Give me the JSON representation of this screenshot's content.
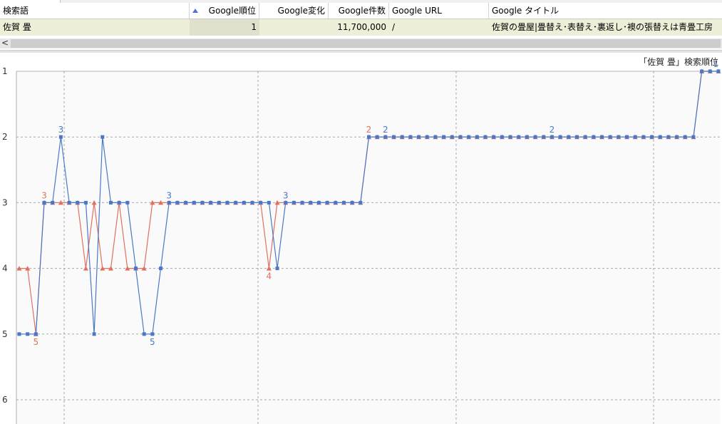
{
  "table": {
    "columns": [
      {
        "key": "keyword",
        "label": "検索語"
      },
      {
        "key": "rank",
        "label": "Google順位"
      },
      {
        "key": "change",
        "label": "Google変化"
      },
      {
        "key": "count",
        "label": "Google件数"
      },
      {
        "key": "url",
        "label": "Google URL"
      },
      {
        "key": "title",
        "label": "Google タイトル"
      }
    ],
    "rows": [
      {
        "keyword": "佐賀 畳",
        "rank": "1",
        "change": "",
        "count": "11,700,000",
        "url": "/",
        "title": "佐賀の畳屋|畳替え･表替え･裏返し･襖の張替えは青畳工房"
      }
    ]
  },
  "scroll": {
    "left_arrow": "<"
  },
  "chart_data": {
    "type": "line",
    "title": "「佐賀 畳」検索順位",
    "xlabel": "",
    "ylabel": "",
    "ylim": [
      1,
      6
    ],
    "y_inverted": true,
    "yticks": [
      "1",
      "2",
      "3",
      "4",
      "5",
      "6"
    ],
    "grid": true,
    "series": [
      {
        "name": "",
        "color": "#e07060",
        "marker": "triangle",
        "values": [
          4,
          4,
          5,
          3,
          3,
          3,
          3,
          3,
          4,
          3,
          4,
          4,
          3,
          4,
          4,
          4,
          3,
          3,
          3,
          3,
          3,
          3,
          3,
          3,
          3,
          3,
          3,
          3,
          3,
          3,
          4,
          3,
          3,
          3,
          3,
          3,
          3,
          3,
          3,
          3,
          3,
          3,
          2,
          2,
          2,
          2,
          2,
          2,
          2,
          2,
          2,
          2,
          2,
          2,
          2,
          2,
          2,
          2,
          2,
          2,
          2,
          2,
          2,
          2,
          2,
          2,
          2,
          2,
          2,
          2,
          2,
          2,
          2,
          2,
          2,
          2,
          2,
          2,
          2,
          2,
          2,
          2,
          1,
          1,
          1
        ]
      },
      {
        "name": "",
        "color": "#4a78c8",
        "marker": "square",
        "values": [
          5,
          5,
          5,
          3,
          3,
          2,
          3,
          3,
          3,
          5,
          2,
          3,
          3,
          3,
          4,
          5,
          5,
          4,
          3,
          3,
          3,
          3,
          3,
          3,
          3,
          3,
          3,
          3,
          3,
          3,
          3,
          4,
          3,
          3,
          3,
          3,
          3,
          3,
          3,
          3,
          3,
          3,
          2,
          2,
          2,
          2,
          2,
          2,
          2,
          2,
          2,
          2,
          2,
          2,
          2,
          2,
          2,
          2,
          2,
          2,
          2,
          2,
          2,
          2,
          2,
          2,
          2,
          2,
          2,
          2,
          2,
          2,
          2,
          2,
          2,
          2,
          2,
          2,
          2,
          2,
          2,
          2,
          1,
          1,
          1
        ]
      }
    ],
    "data_labels": [
      {
        "series": 0,
        "index": 2,
        "text": "5"
      },
      {
        "series": 0,
        "index": 3,
        "text": "3"
      },
      {
        "series": 1,
        "index": 5,
        "text": "3"
      },
      {
        "series": 1,
        "index": 16,
        "text": "5"
      },
      {
        "series": 1,
        "index": 18,
        "text": "3"
      },
      {
        "series": 0,
        "index": 30,
        "text": "4"
      },
      {
        "series": 1,
        "index": 32,
        "text": "3"
      },
      {
        "series": 0,
        "index": 42,
        "text": "2"
      },
      {
        "series": 1,
        "index": 44,
        "text": "2"
      },
      {
        "series": 1,
        "index": 64,
        "text": "2"
      },
      {
        "series": 1,
        "index": 84,
        "text": "1"
      }
    ]
  }
}
